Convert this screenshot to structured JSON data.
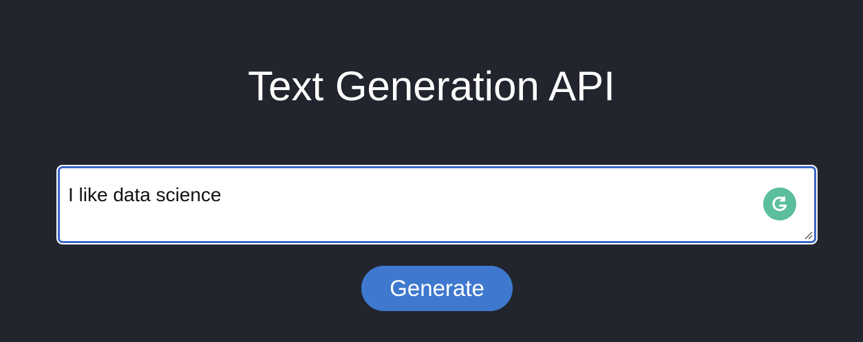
{
  "page": {
    "title": "Text Generation API"
  },
  "prompt": {
    "value": "I like data science",
    "assist_icon": "grammarly-icon"
  },
  "actions": {
    "generate_label": "Generate"
  },
  "colors": {
    "background": "#22252d",
    "input_border": "#3a67c7",
    "button": "#3f79cf",
    "assist_icon": "#5cbf9b"
  }
}
